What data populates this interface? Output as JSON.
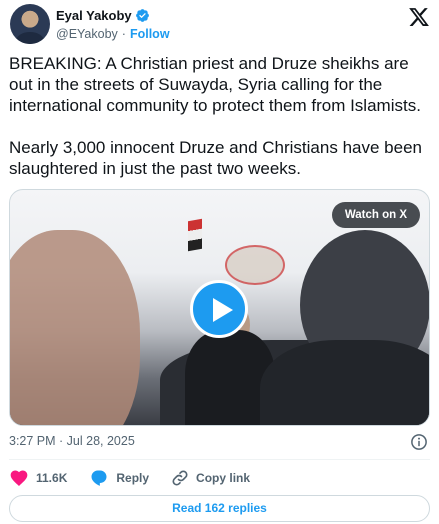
{
  "author": {
    "name": "Eyal Yakoby",
    "handle": "@EYakoby",
    "separator": "·",
    "follow_label": "Follow",
    "verified": true
  },
  "tweet": {
    "paragraphs": [
      "BREAKING: A Christian priest and Druze sheikhs are out in the streets of Suwayda, Syria calling for the international community to protect them from Islamists.",
      "Nearly 3,000 innocent Druze and Christians have been slaughtered in just the past two weeks."
    ]
  },
  "media": {
    "watch_label": "Watch on X",
    "icon": "play-icon"
  },
  "meta": {
    "timestamp": "3:27 PM · Jul 28, 2025"
  },
  "actions": {
    "like_count": "11.6K",
    "reply_label": "Reply",
    "copy_label": "Copy link"
  },
  "read_replies_label": "Read 162 replies",
  "colors": {
    "accent": "#1d9bf0",
    "like": "#f91880",
    "text": "#0f1419",
    "muted": "#536471"
  }
}
